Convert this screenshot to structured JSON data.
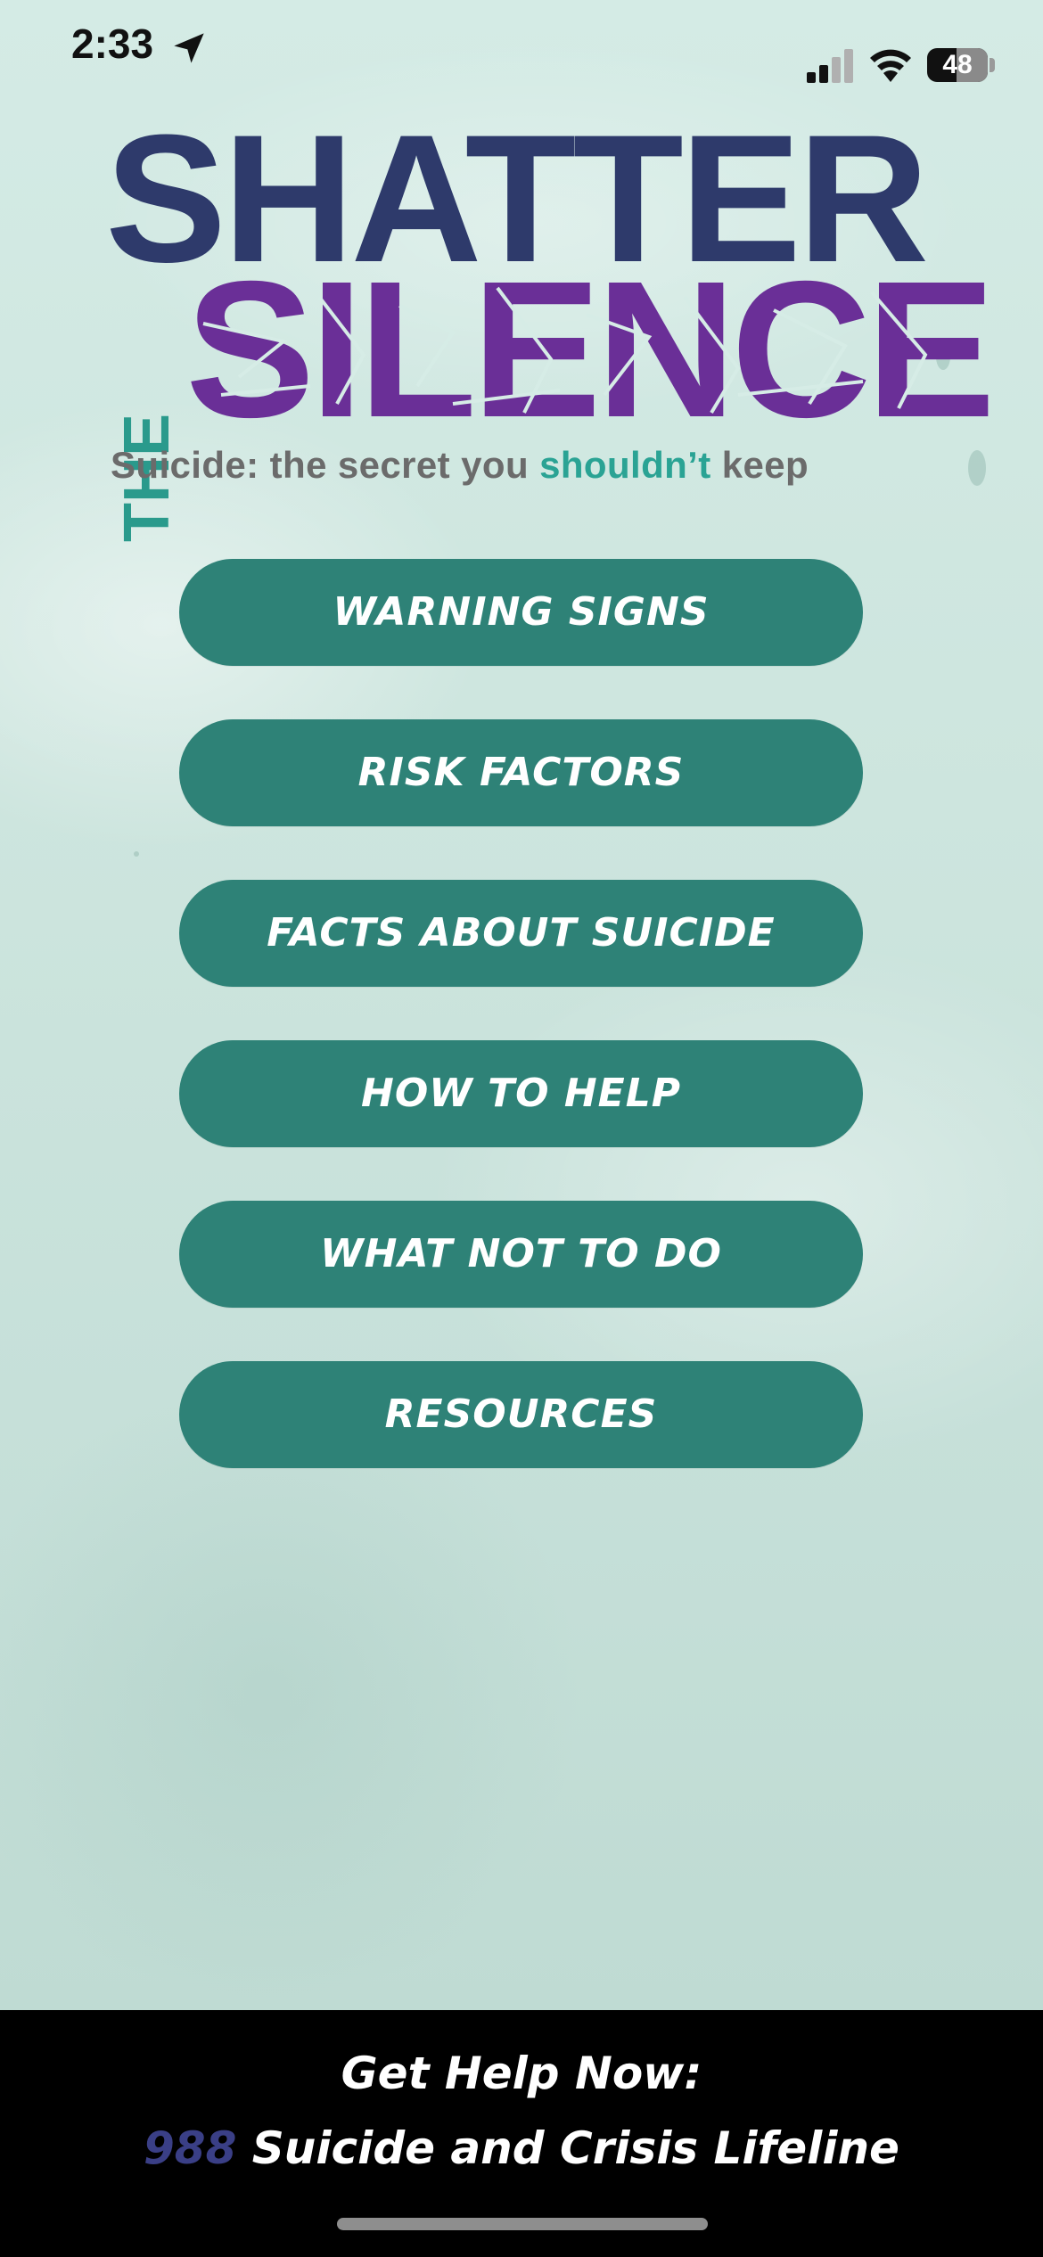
{
  "status_bar": {
    "time": "2:33",
    "battery": "48",
    "battery_level": 48
  },
  "logo": {
    "shatter": "SHATTER",
    "the": "THE",
    "silence": "SILENCE",
    "tagline_part1": "Suicide: the secret you ",
    "tagline_accent": "shouldn’t",
    "tagline_part2": " keep"
  },
  "menu": {
    "items": [
      {
        "label": "WARNING SIGNS"
      },
      {
        "label": "RISK FACTORS"
      },
      {
        "label": "FACTS ABOUT SUICIDE"
      },
      {
        "label": "HOW TO HELP"
      },
      {
        "label": "WHAT NOT TO DO"
      },
      {
        "label": "RESOURCES"
      }
    ]
  },
  "footer": {
    "title": "Get Help Now:",
    "hotline_number": "988",
    "hotline_name": " Suicide and Crisis Lifeline"
  },
  "colors": {
    "button": "#2e8277",
    "logo_navy": "#2e3a6b",
    "logo_purple": "#6a2f97",
    "logo_teal": "#2a9a8c",
    "footer_bg": "#000000",
    "hotline_number": "#3a3f86"
  },
  "icons": {
    "location": "location-arrow-icon",
    "signal": "cellular-signal-icon",
    "wifi": "wifi-icon",
    "battery": "battery-icon"
  }
}
